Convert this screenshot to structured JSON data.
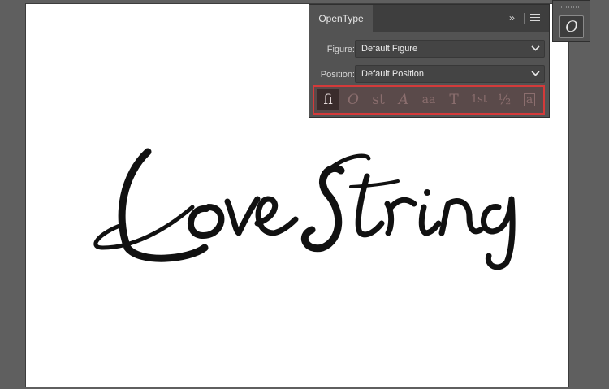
{
  "artwork": {
    "text": "Love String"
  },
  "panel": {
    "tab_label": "OpenType",
    "collapse_icon": "double-chevron-right-icon",
    "menu_icon": "hamburger-menu-icon",
    "figure": {
      "label": "Figure:",
      "value": "Default Figure"
    },
    "position": {
      "label": "Position:",
      "value": "Default Position"
    },
    "features": [
      {
        "id": "ligatures",
        "glyph": "fi",
        "active": true
      },
      {
        "id": "swash",
        "glyph": "O",
        "active": false
      },
      {
        "id": "discretionary-ligatures",
        "glyph": "st",
        "active": false
      },
      {
        "id": "titling",
        "glyph": "A",
        "active": false
      },
      {
        "id": "contextual-alternates",
        "glyph": "aa",
        "active": false
      },
      {
        "id": "stylistic-sets",
        "glyph": "T",
        "active": false
      },
      {
        "id": "ordinals",
        "glyph": "1st",
        "active": false
      },
      {
        "id": "fractions",
        "glyph": "½",
        "active": false
      },
      {
        "id": "stylistic-alternates",
        "glyph": "a",
        "active": false
      }
    ]
  },
  "mini_panel": {
    "glyph": "O"
  },
  "colors": {
    "highlight": "#d43a3a",
    "panel_bg": "#535353",
    "workspace": "#5f5f5f"
  }
}
